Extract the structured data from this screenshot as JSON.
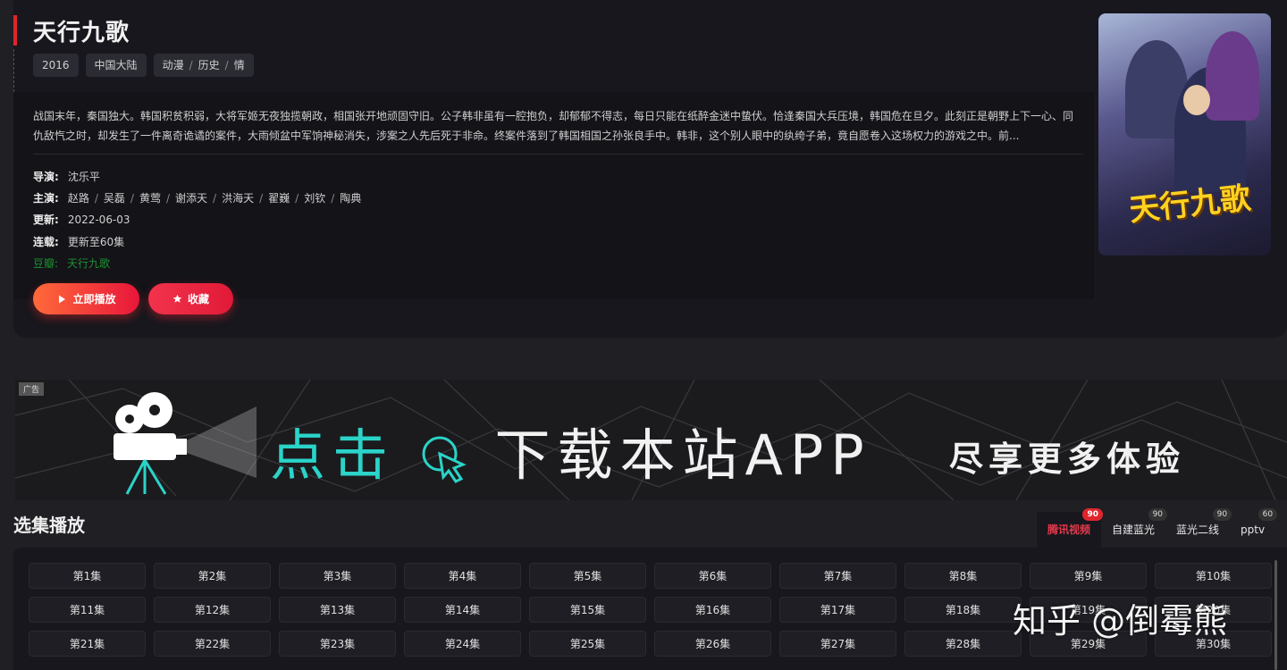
{
  "detail": {
    "title": "天行九歌",
    "tags": {
      "year": "2016",
      "region": "中国大陆",
      "genres": [
        "动漫",
        "历史",
        "情"
      ]
    },
    "description": "战国末年，秦国独大。韩国积贫积弱，大将军姬无夜独揽朝政，相国张开地顽固守旧。公子韩非虽有一腔抱负，却郁郁不得志，每日只能在纸醉金迷中蛰伏。恰逢秦国大兵压境，韩国危在旦夕。此刻正是朝野上下一心、同仇敌忾之时，却发生了一件离奇诡谲的案件，大雨倾盆中军饷神秘消失，涉案之人先后死于非命。终案件落到了韩国相国之孙张良手中。韩非，这个别人眼中的纨绔子弟，竟自愿卷入这场权力的游戏之中。前...",
    "director_label": "导演:",
    "director": "沈乐平",
    "cast_label": "主演:",
    "cast": [
      "赵路",
      "吴磊",
      "黄莺",
      "谢添天",
      "洪海天",
      "翟巍",
      "刘钦",
      "陶典"
    ],
    "update_label": "更新:",
    "update": "2022-06-03",
    "serial_label": "连载:",
    "serial": "更新至60集",
    "douban_label": "豆瓣:",
    "douban": "天行九歌",
    "play_button": "立即播放",
    "fav_button": "收藏",
    "poster_title": "天行九歌"
  },
  "banner": {
    "ad_label": "广告",
    "text_cyan": "点击",
    "text_main": "下载本站APP",
    "text_sub": "尽享更多体验"
  },
  "episodes": {
    "section_title": "选集播放",
    "sources": [
      {
        "name": "腾讯视频",
        "count": "90",
        "active": true
      },
      {
        "name": "自建蓝光",
        "count": "90",
        "active": false
      },
      {
        "name": "蓝光二线",
        "count": "90",
        "active": false
      },
      {
        "name": "pptv",
        "count": "60",
        "active": false
      }
    ],
    "list": [
      "第1集",
      "第2集",
      "第3集",
      "第4集",
      "第5集",
      "第6集",
      "第7集",
      "第8集",
      "第9集",
      "第10集",
      "第11集",
      "第12集",
      "第13集",
      "第14集",
      "第15集",
      "第16集",
      "第17集",
      "第18集",
      "第19集",
      "第20集",
      "第21集",
      "第22集",
      "第23集",
      "第24集",
      "第25集",
      "第26集",
      "第27集",
      "第28集",
      "第29集",
      "第30集"
    ]
  },
  "watermark": "知乎 @倒霉熊",
  "colors": {
    "accent": "#e1252d",
    "douban": "#1f8f33",
    "banner_cyan": "#2bd3c8"
  }
}
